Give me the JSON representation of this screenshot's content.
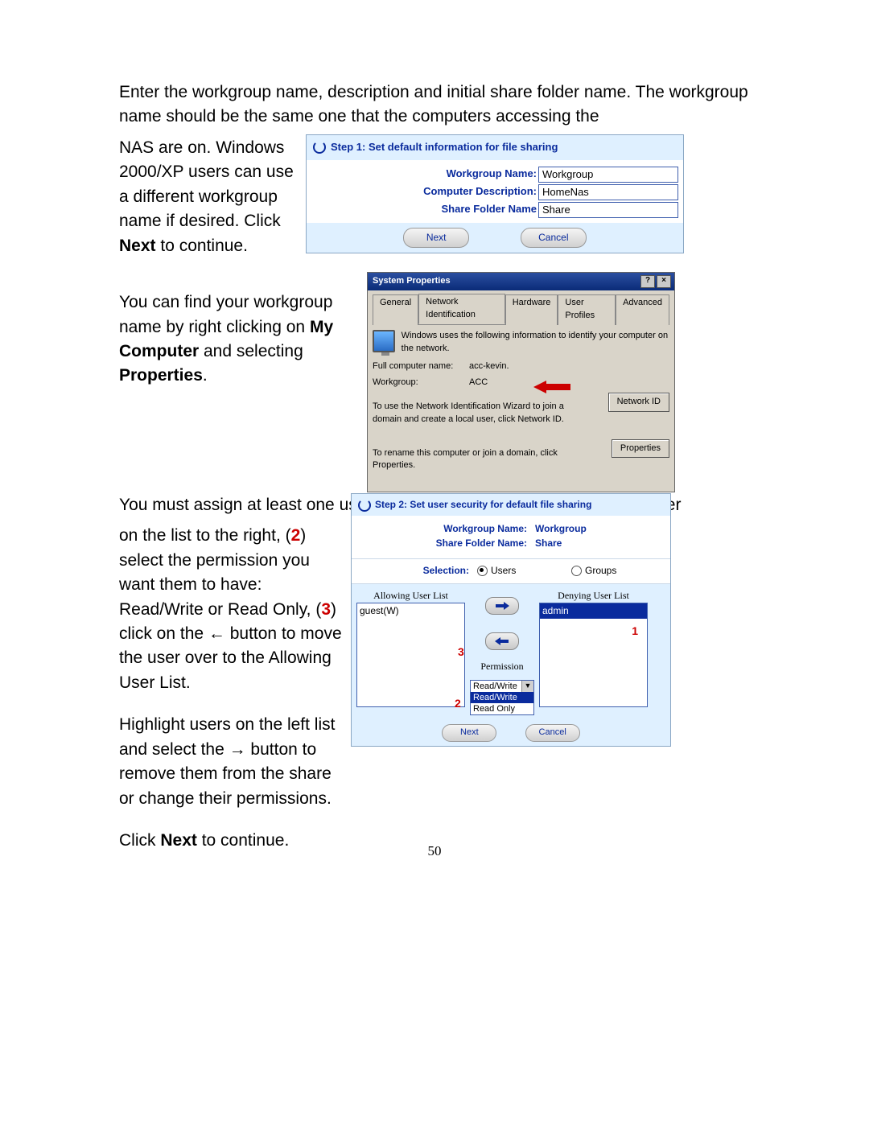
{
  "para1": "Enter the workgroup name, description and initial share folder name. The workgroup name should be the same one that the computers accessing the",
  "para1b_a": "NAS are on. Windows 2000/XP users can use a different workgroup name if desired. Click ",
  "para1b_b": "Next",
  "para1b_c": " to continue.",
  "para2_a": "You can find your workgroup name by right clicking on ",
  "para2_b": "My Computer",
  "para2_c": " and selecting ",
  "para2_d": "Properties",
  "para2_e": ".",
  "para3_a": "You must assign at least one user to this share folder. (",
  "para3_b": ") Highlight the user",
  "para3_c_a": "on the list to the right, (",
  "para3_c_b": ") select the permission you want them to have: Read/Write or Read Only, (",
  "para3_c_c": ") click on the ← button to move the user over to the Allowing User List.",
  "para4": "Highlight users on the left list and select the → button to remove them from the share or change their permissions.",
  "para5_a": "Click ",
  "para5_b": "Next",
  "para5_c": " to continue.",
  "nums": {
    "one": "1",
    "two": "2",
    "three": "3"
  },
  "page_number": "50",
  "step1": {
    "title": "Step 1: Set default information for file sharing",
    "labels": {
      "workgroup": "Workgroup Name:",
      "desc": "Computer Description:",
      "share": "Share Folder Name"
    },
    "values": {
      "workgroup": "Workgroup",
      "desc": "HomeNas",
      "share": "Share"
    },
    "next": "Next",
    "cancel": "Cancel"
  },
  "sysprop": {
    "title": "System Properties",
    "tabs": [
      "General",
      "Network Identification",
      "Hardware",
      "User Profiles",
      "Advanced"
    ],
    "intro": "Windows uses the following information to identify your computer on the network.",
    "full_name_label": "Full computer name:",
    "full_name_value": "acc-kevin.",
    "workgroup_label": "Workgroup:",
    "workgroup_value": "ACC",
    "net_id_text": "To use the Network Identification Wizard to join a domain and create a local user, click Network ID.",
    "net_id_btn": "Network ID",
    "prop_text": "To rename this computer or join a domain, click Properties.",
    "prop_btn": "Properties",
    "help": "?",
    "close": "×"
  },
  "step2": {
    "title": "Step 2: Set user security for default file sharing",
    "workgroup_label": "Workgroup Name:",
    "workgroup_value": "Workgroup",
    "share_label": "Share Folder Name:",
    "share_value": "Share",
    "selection_label": "Selection:",
    "opt_users": "Users",
    "opt_groups": "Groups",
    "allow_title": "Allowing User List",
    "deny_title": "Denying User List",
    "allow_item": "guest(W)",
    "deny_item": "admin",
    "perm_label": "Permission",
    "perm_options": [
      "Read/Write",
      "Read/Write",
      "Read Only"
    ],
    "next": "Next",
    "cancel": "Cancel",
    "n1": "1",
    "n2": "2",
    "n3": "3"
  }
}
